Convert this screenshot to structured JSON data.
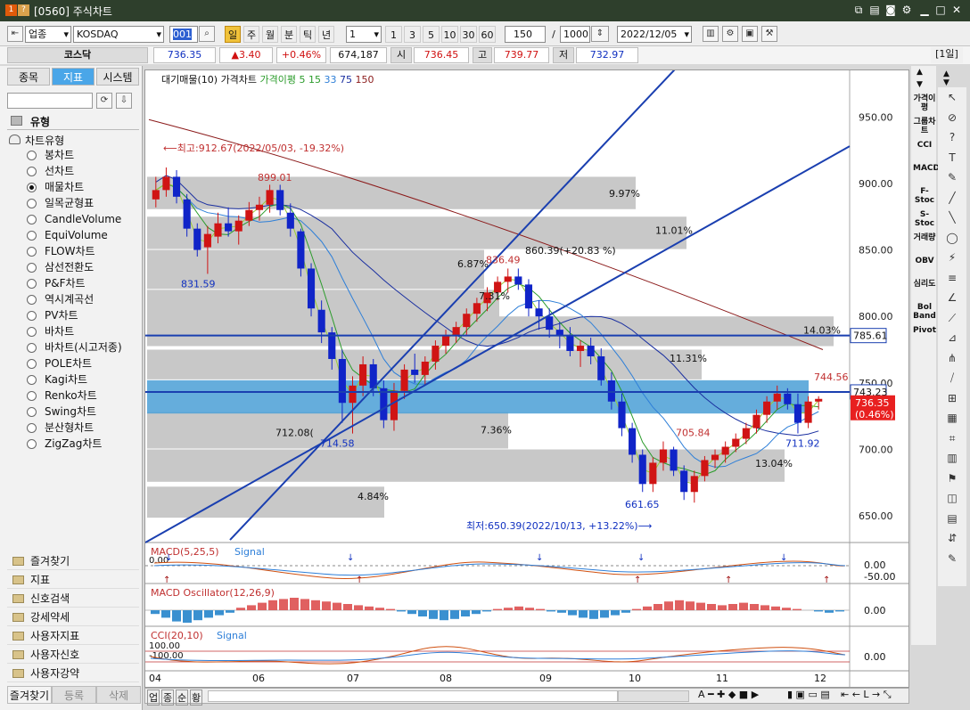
{
  "window": {
    "title_code": "[0560]",
    "title": "주식차트"
  },
  "toolbar": {
    "market": "업종",
    "code": "KOSDAQ",
    "search_value": "001",
    "periods": [
      "일",
      "주",
      "월",
      "분",
      "틱",
      "년"
    ],
    "interval_value": "1",
    "interval_buttons": [
      "1",
      "3",
      "5",
      "10",
      "30",
      "60"
    ],
    "count": "150",
    "total": "1000",
    "date": "2022/12/05"
  },
  "pricebar": {
    "name": "코스닥",
    "last": "736.35",
    "change": "▲3.40",
    "change_pct": "+0.46%",
    "volume": "674,187",
    "open_label": "시",
    "open": "736.45",
    "high_label": "고",
    "high": "739.77",
    "low_label": "저",
    "low": "732.97",
    "period_tag": "[1일]"
  },
  "leftpanel": {
    "tabs": [
      "종목",
      "지표",
      "시스템"
    ],
    "section_title": "유형",
    "group_title": "차트유형",
    "chart_types": [
      "봉차트",
      "선차트",
      "매물차트",
      "일목균형표",
      "CandleVolume",
      "EquiVolume",
      "FLOW차트",
      "삼선전환도",
      "P&F차트",
      "역시계곡선",
      "PV차트",
      "바차트",
      "바차트(시고저종)",
      "POLE차트",
      "Kagi차트",
      "Renko차트",
      "Swing차트",
      "분산형차트",
      "ZigZag차트"
    ],
    "selected_index": 2,
    "accordion": [
      "즐겨찾기",
      "지표",
      "신호검색",
      "강세약세",
      "사용자지표",
      "사용자신호",
      "사용자강약"
    ],
    "bottom_tabs": [
      "즐겨찾기",
      "등록",
      "삭제"
    ]
  },
  "chart": {
    "legend": {
      "vol": "대기매물(10)",
      "price": "가격차트",
      "ma_title": "가격이평",
      "ma": [
        "5",
        "15",
        "33",
        "75",
        "150"
      ]
    },
    "y_ticks": [
      "950.00",
      "900.00",
      "850.00",
      "800.00",
      "750.00",
      "700.00",
      "650.00"
    ],
    "x_ticks": [
      "04",
      "06",
      "07",
      "08",
      "09",
      "10",
      "11",
      "12"
    ],
    "annotations": {
      "max": "⟵최고:912.67(2022/05/03, -19.32%)",
      "min": "최저:650.39(2022/10/13, +13.22%)⟶",
      "p899": "899.01",
      "p831": "831.59",
      "p836": "836.49",
      "p712a": "712.08(",
      "p714": "714.58",
      "p661": "661.65",
      "p705": "705.84",
      "p744": "744.56",
      "p711": "711.92",
      "vp": [
        "9.97%",
        "11.01%",
        "860.39(+20.83 %)",
        "6.87%",
        "7.31%",
        "14.03%",
        "11.31%",
        "7.36%",
        "13.04%",
        "4.84%"
      ]
    },
    "price_line_1": "785.61",
    "price_line_2": "743.23",
    "last_tag": "736.35",
    "last_tag_pct": "(0.46%)",
    "macd": {
      "label": "MACD(5,25,5)",
      "signal": "Signal",
      "ticks": [
        "0.00",
        "-50.00"
      ],
      "zero_label": "0.00"
    },
    "osc": {
      "label": "MACD Oscillator(12,26,9)",
      "tick": "0.00"
    },
    "cci": {
      "label": "CCI(20,10)",
      "signal": "Signal",
      "tick": "0.00",
      "upper": "100.00",
      "lower": "-100.00"
    }
  },
  "right_tools": [
    "가격이평",
    "그룹차트",
    "CCI",
    "MACD",
    "F-Stoc",
    "S-Stoc",
    "거래량",
    "OBV",
    "심리도",
    "Bol Band",
    "Pivot"
  ],
  "chart_data": {
    "type": "candlestick",
    "yrange": [
      630,
      985
    ],
    "ohlc": [
      [
        888,
        905,
        882,
        895
      ],
      [
        895,
        912,
        890,
        905
      ],
      [
        905,
        910,
        885,
        890
      ],
      [
        888,
        892,
        860,
        866
      ],
      [
        866,
        870,
        845,
        850
      ],
      [
        852,
        868,
        832,
        862
      ],
      [
        860,
        878,
        855,
        870
      ],
      [
        870,
        882,
        860,
        864
      ],
      [
        864,
        876,
        854,
        872
      ],
      [
        872,
        886,
        868,
        880
      ],
      [
        880,
        890,
        872,
        884
      ],
      [
        884,
        899,
        878,
        895
      ],
      [
        895,
        899,
        876,
        880
      ],
      [
        878,
        885,
        860,
        866
      ],
      [
        864,
        866,
        830,
        836
      ],
      [
        836,
        840,
        800,
        806
      ],
      [
        805,
        812,
        780,
        788
      ],
      [
        788,
        792,
        760,
        768
      ],
      [
        768,
        775,
        720,
        735
      ],
      [
        735,
        755,
        712,
        748
      ],
      [
        748,
        770,
        740,
        764
      ],
      [
        764,
        768,
        740,
        746
      ],
      [
        746,
        752,
        716,
        722
      ],
      [
        722,
        750,
        714,
        744
      ],
      [
        744,
        764,
        738,
        760
      ],
      [
        760,
        772,
        750,
        756
      ],
      [
        756,
        770,
        748,
        766
      ],
      [
        766,
        782,
        760,
        778
      ],
      [
        778,
        790,
        772,
        786
      ],
      [
        786,
        796,
        780,
        792
      ],
      [
        792,
        806,
        786,
        802
      ],
      [
        802,
        814,
        796,
        810
      ],
      [
        810,
        822,
        804,
        818
      ],
      [
        818,
        830,
        812,
        826
      ],
      [
        826,
        836,
        818,
        830
      ],
      [
        830,
        836,
        820,
        824
      ],
      [
        824,
        828,
        800,
        806
      ],
      [
        806,
        812,
        790,
        800
      ],
      [
        800,
        806,
        784,
        790
      ],
      [
        790,
        796,
        776,
        786
      ],
      [
        786,
        792,
        770,
        774
      ],
      [
        774,
        782,
        762,
        778
      ],
      [
        778,
        784,
        764,
        770
      ],
      [
        770,
        776,
        748,
        752
      ],
      [
        752,
        758,
        730,
        736
      ],
      [
        736,
        742,
        710,
        716
      ],
      [
        716,
        720,
        690,
        696
      ],
      [
        696,
        700,
        668,
        674
      ],
      [
        674,
        694,
        668,
        690
      ],
      [
        690,
        706,
        684,
        700
      ],
      [
        700,
        702,
        680,
        684
      ],
      [
        684,
        688,
        662,
        668
      ],
      [
        668,
        684,
        660,
        680
      ],
      [
        680,
        695,
        676,
        692
      ],
      [
        692,
        700,
        686,
        696
      ],
      [
        696,
        706,
        690,
        702
      ],
      [
        702,
        712,
        698,
        708
      ],
      [
        708,
        720,
        704,
        716
      ],
      [
        716,
        730,
        712,
        726
      ],
      [
        726,
        740,
        720,
        736
      ],
      [
        736,
        748,
        730,
        742
      ],
      [
        742,
        746,
        730,
        734
      ],
      [
        734,
        742,
        712,
        720
      ],
      [
        720,
        740,
        716,
        736
      ],
      [
        736,
        740,
        730,
        738
      ]
    ],
    "volume_profile_pct": [
      9.97,
      11.01,
      20.83,
      6.87,
      7.31,
      14.03,
      11.31,
      7.36,
      13.04,
      4.84
    ]
  }
}
